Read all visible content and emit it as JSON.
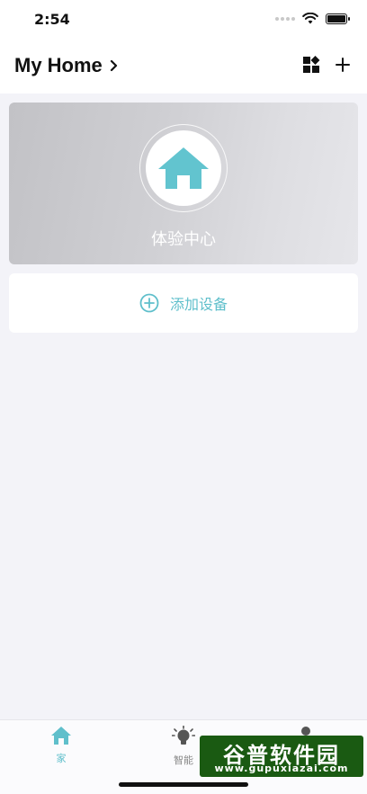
{
  "status_bar": {
    "time": "2:54"
  },
  "header": {
    "title": "My Home"
  },
  "experience_card": {
    "label": "体验中心"
  },
  "add_device": {
    "label": "添加设备"
  },
  "tabs": [
    {
      "label": "家",
      "icon": "home-icon"
    },
    {
      "label": "智能",
      "icon": "lightbulb-icon"
    },
    {
      "label": "",
      "icon": "person-icon"
    }
  ],
  "watermark": {
    "brand": "谷普软件园",
    "url": "www.gupuxiazai.com"
  },
  "colors": {
    "accent": "#5fbfcb",
    "background": "#f3f3f8",
    "card_gray": "#cfcfd3"
  }
}
